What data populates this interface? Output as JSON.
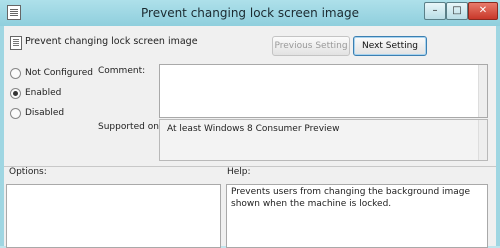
{
  "window": {
    "title": "Prevent changing lock screen image",
    "controls": {
      "minimize": "–",
      "maximize": "□",
      "close": "✕"
    }
  },
  "header": {
    "setting_name": "Prevent changing lock screen image"
  },
  "toolbar": {
    "previous_label": "Previous Setting",
    "next_label": "Next Setting"
  },
  "state": {
    "options": [
      {
        "label": "Not Configured",
        "selected": false
      },
      {
        "label": "Enabled",
        "selected": true
      },
      {
        "label": "Disabled",
        "selected": false
      }
    ]
  },
  "comment": {
    "label": "Comment:",
    "value": ""
  },
  "supported": {
    "label": "Supported on:",
    "value": "At least Windows 8 Consumer Preview"
  },
  "options_panel": {
    "label": "Options:"
  },
  "help_panel": {
    "label": "Help:",
    "text": "Prevents users from changing the background image shown when the machine is locked."
  },
  "icons": {
    "window": "policy-document-icon",
    "header": "policy-document-icon"
  }
}
